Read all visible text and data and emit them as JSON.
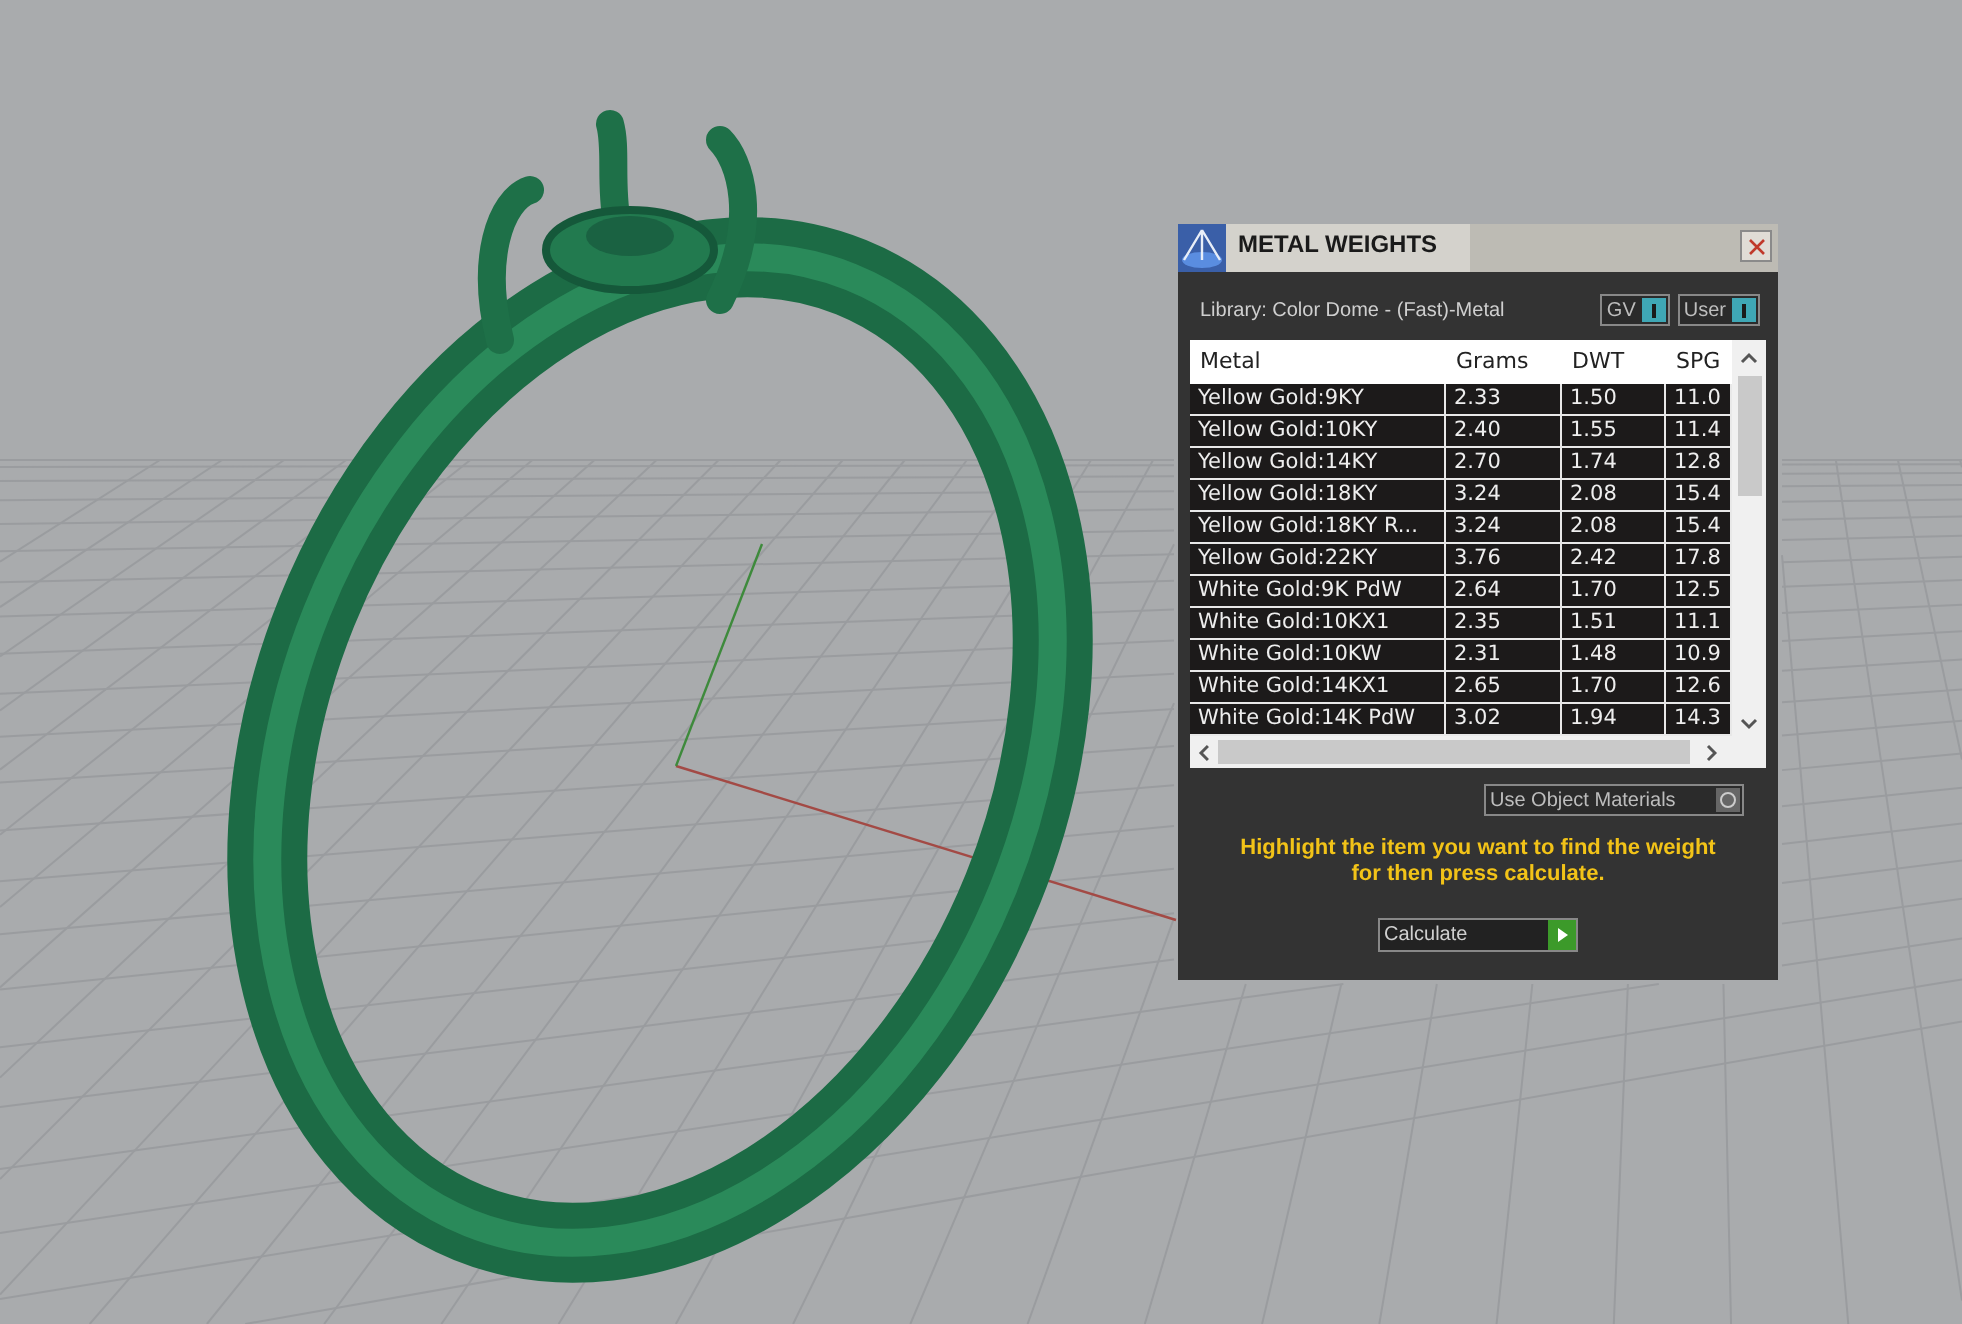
{
  "window": {
    "title": "METAL WEIGHTS"
  },
  "library": "Library: Color Dome - (Fast)-Metal",
  "toggles": [
    {
      "label": "GV"
    },
    {
      "label": "User"
    }
  ],
  "table": {
    "columns": [
      "Metal",
      "Grams",
      "DWT",
      "SPG"
    ],
    "rows": [
      [
        "Yellow Gold:9KY",
        "2.33",
        "1.50",
        "11.0"
      ],
      [
        "Yellow Gold:10KY",
        "2.40",
        "1.55",
        "11.4"
      ],
      [
        "Yellow Gold:14KY",
        "2.70",
        "1.74",
        "12.8"
      ],
      [
        "Yellow Gold:18KY",
        "3.24",
        "2.08",
        "15.4"
      ],
      [
        "Yellow Gold:18KY R...",
        "3.24",
        "2.08",
        "15.4"
      ],
      [
        "Yellow Gold:22KY",
        "3.76",
        "2.42",
        "17.8"
      ],
      [
        "White Gold:9K PdW",
        "2.64",
        "1.70",
        "12.5"
      ],
      [
        "White Gold:10KX1",
        "2.35",
        "1.51",
        "11.1"
      ],
      [
        "White Gold:10KW",
        "2.31",
        "1.48",
        "10.9"
      ],
      [
        "White Gold:14KX1",
        "2.65",
        "1.70",
        "12.6"
      ],
      [
        "White Gold:14K PdW",
        "3.02",
        "1.94",
        "14.3"
      ]
    ]
  },
  "use_object_materials": {
    "label": "Use Object Materials"
  },
  "instruction": "Highlight the item you want to find the weight for then press calculate.",
  "calculate_button": {
    "label": "Calculate"
  }
}
